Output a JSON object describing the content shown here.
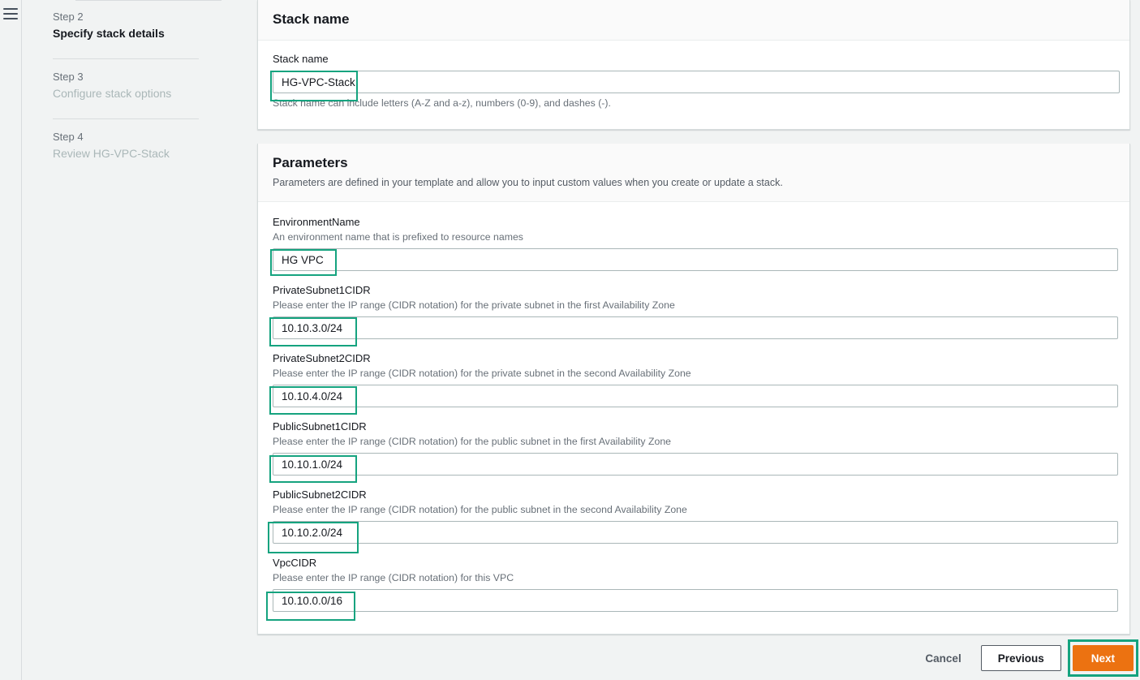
{
  "nav": {
    "menu_icon": "hamburger-menu-icon",
    "steps": [
      {
        "number": "Step 2",
        "title": "Specify stack details",
        "state": "active"
      },
      {
        "number": "Step 3",
        "title": "Configure stack options",
        "state": "inactive"
      },
      {
        "number": "Step 4",
        "title": "Review HG-VPC-Stack",
        "state": "inactive"
      }
    ]
  },
  "stack_name_section": {
    "heading": "Stack name",
    "field": {
      "label": "Stack name",
      "value": "HG-VPC-Stack",
      "placeholder": "",
      "hint": "Stack name can include letters (A-Z and a-z), numbers (0-9), and dashes (-)."
    }
  },
  "parameters_section": {
    "heading": "Parameters",
    "description": "Parameters are defined in your template and allow you to input custom values when you create or update a stack.",
    "fields": [
      {
        "label": "EnvironmentName",
        "description": "An environment name that is prefixed to resource names",
        "value": "HG VPC"
      },
      {
        "label": "PrivateSubnet1CIDR",
        "description": "Please enter the IP range (CIDR notation) for the private subnet in the first Availability Zone",
        "value": "10.10.3.0/24"
      },
      {
        "label": "PrivateSubnet2CIDR",
        "description": "Please enter the IP range (CIDR notation) for the private subnet in the second Availability Zone",
        "value": "10.10.4.0/24"
      },
      {
        "label": "PublicSubnet1CIDR",
        "description": "Please enter the IP range (CIDR notation) for the public subnet in the first Availability Zone",
        "value": "10.10.1.0/24"
      },
      {
        "label": "PublicSubnet2CIDR",
        "description": "Please enter the IP range (CIDR notation) for the public subnet in the second Availability Zone",
        "value": "10.10.2.0/24"
      },
      {
        "label": "VpcCIDR",
        "description": "Please enter the IP range (CIDR notation) for this VPC",
        "value": "10.10.0.0/16"
      }
    ]
  },
  "footer": {
    "cancel_label": "Cancel",
    "previous_label": "Previous",
    "next_label": "Next"
  },
  "colors": {
    "highlight": "#15a37f",
    "primary_button": "#ec7211",
    "page_background": "#f1f3f3",
    "text": "#16191f",
    "muted_text": "#687078"
  }
}
